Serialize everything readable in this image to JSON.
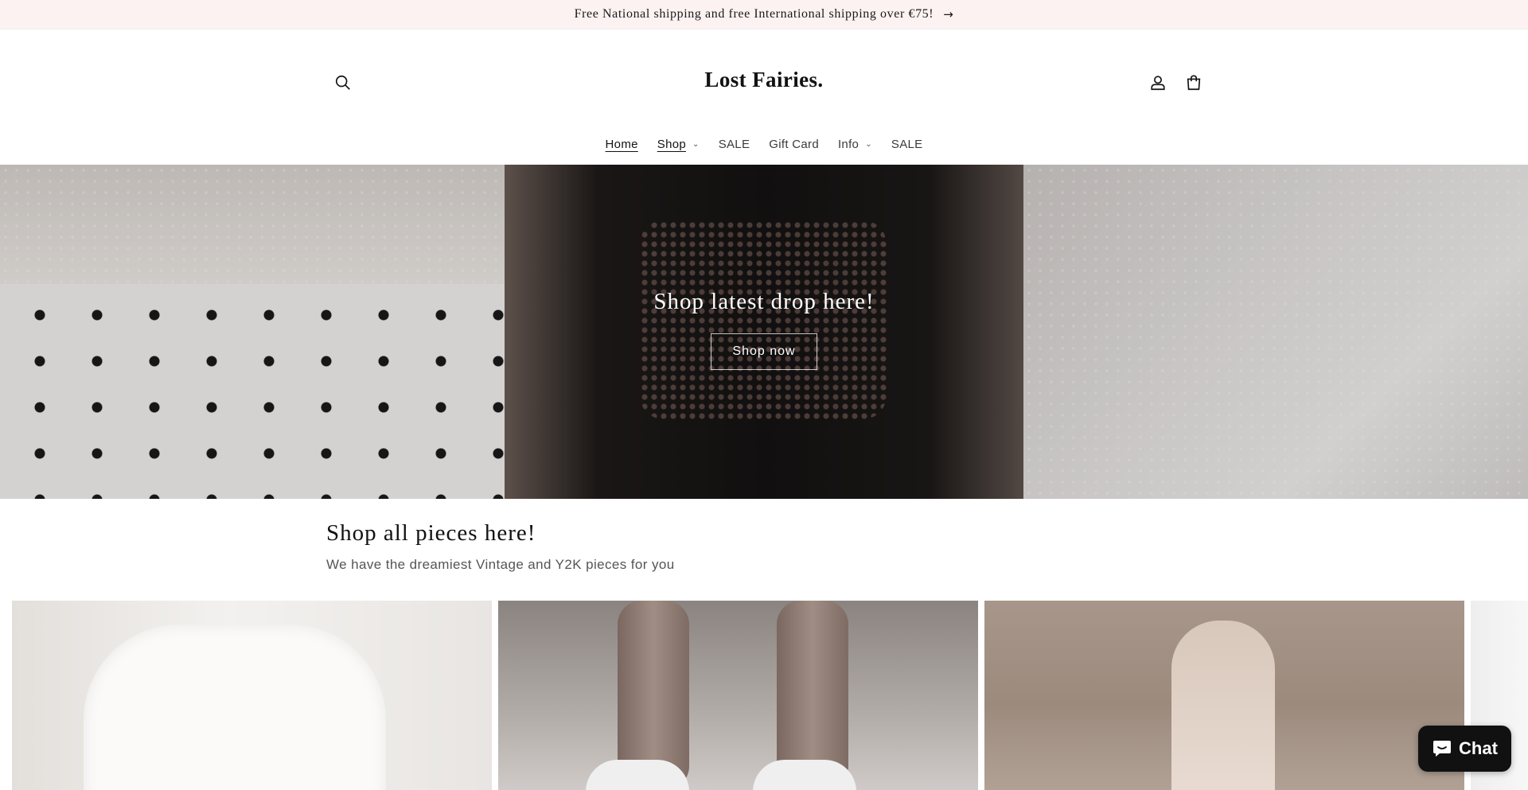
{
  "announcement": {
    "text": "Free National shipping and free International shipping over €75!",
    "arrow": "→"
  },
  "header": {
    "logo": "Lost Fairies.",
    "icons": {
      "search": "search-icon",
      "account": "account-icon",
      "cart": "cart-icon"
    }
  },
  "nav": {
    "items": [
      {
        "label": "Home",
        "active": true,
        "dropdown": false
      },
      {
        "label": "Shop",
        "active": true,
        "dropdown": true
      },
      {
        "label": "SALE",
        "active": false,
        "dropdown": false
      },
      {
        "label": "Gift Card",
        "active": false,
        "dropdown": false
      },
      {
        "label": "Info",
        "active": false,
        "dropdown": true
      },
      {
        "label": "SALE",
        "active": false,
        "dropdown": false
      }
    ]
  },
  "hero": {
    "title": "Shop latest drop here!",
    "button_label": "Shop now"
  },
  "collection": {
    "title": "Shop all pieces here!",
    "subtitle": "We have the dreamiest Vintage and Y2K pieces for you"
  },
  "chat": {
    "label": "Chat",
    "icon": "chat-bubble-icon"
  },
  "colors": {
    "announcement_bg": "#fdf2f2",
    "text": "#121212",
    "chat_bg": "#111111"
  }
}
